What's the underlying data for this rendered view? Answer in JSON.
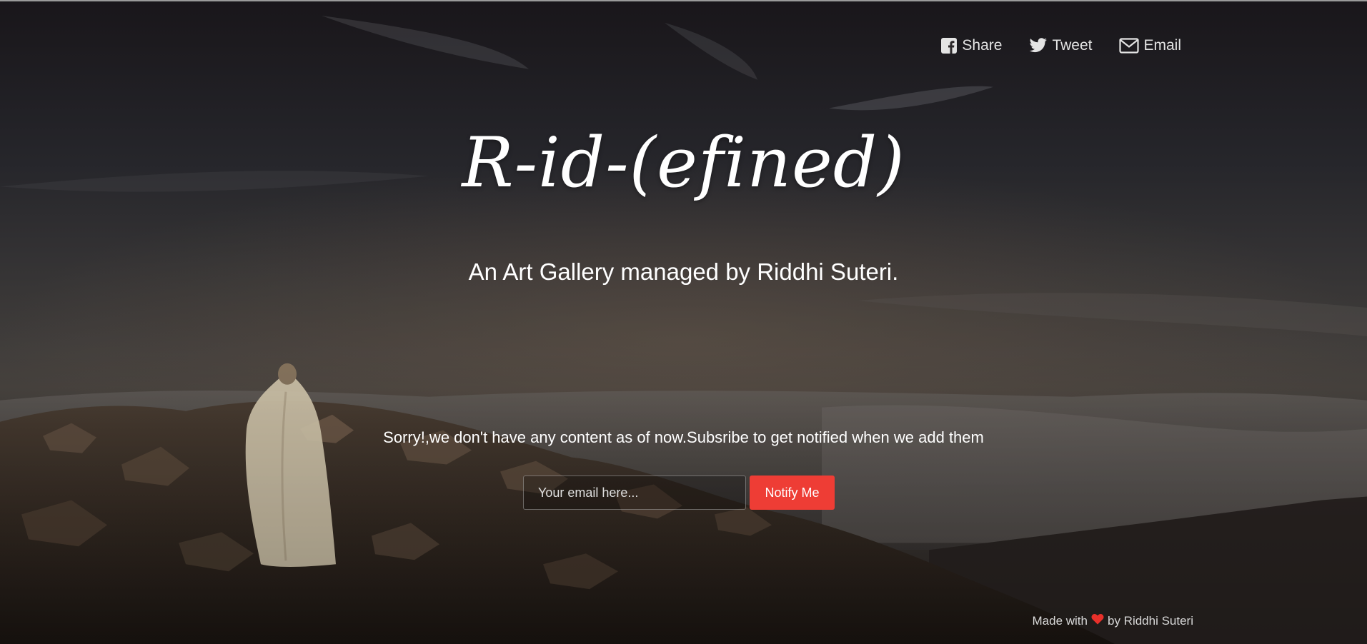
{
  "share_bar": {
    "items": [
      {
        "icon": "facebook-icon",
        "label": "Share"
      },
      {
        "icon": "twitter-icon",
        "label": "Tweet"
      },
      {
        "icon": "envelope-icon",
        "label": "Email"
      }
    ]
  },
  "hero": {
    "title": "R-id-(efined)",
    "subtitle": "An Art Gallery managed by Riddhi Suteri."
  },
  "subscribe": {
    "notice": "Sorry!,we don't have any content as of now.Subsribe to get notified when we add them",
    "email_placeholder": "Your email here...",
    "email_value": "",
    "button_label": "Notify Me"
  },
  "footer": {
    "prefix": "Made with",
    "heart_icon": "heart-icon",
    "suffix": "by Riddhi Suteri"
  },
  "colors": {
    "accent": "#ee3d35",
    "heart": "#e8302a",
    "text": "#ffffff"
  }
}
